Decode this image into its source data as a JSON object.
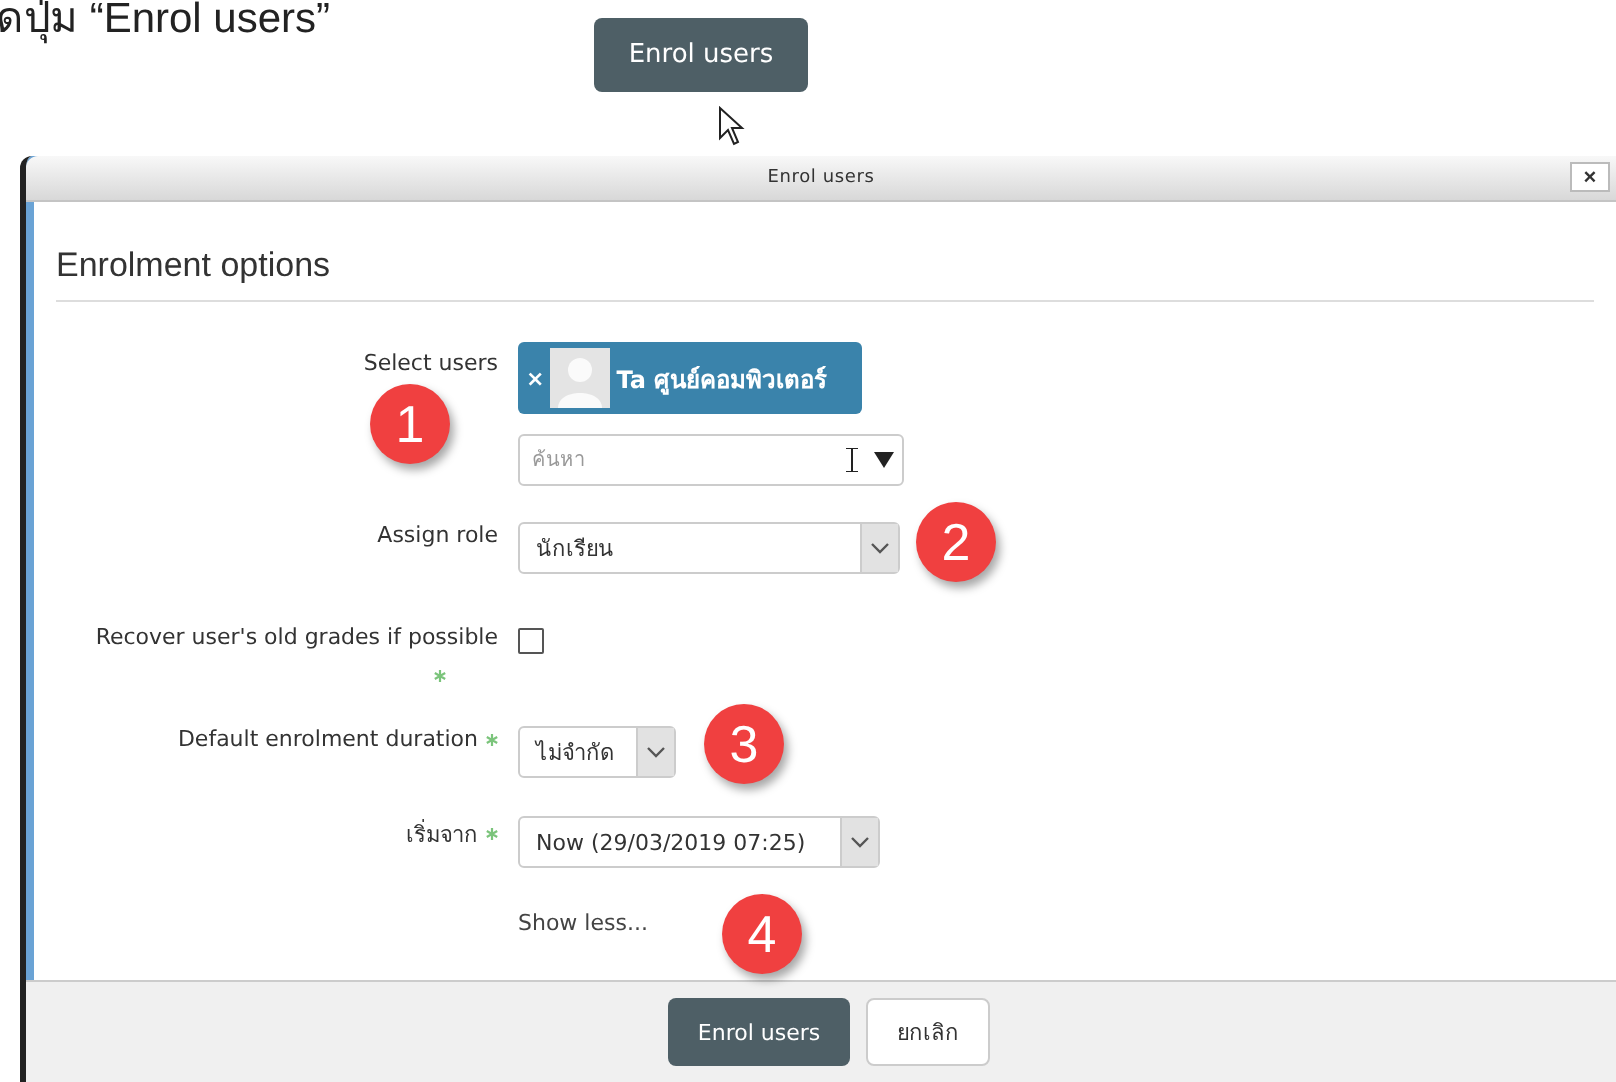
{
  "instruction": {
    "text": "ดปุ่ม “Enrol users”"
  },
  "trigger_button": {
    "label": "Enrol users"
  },
  "dialog": {
    "title": "Enrol users",
    "close": "×",
    "heading": "Enrolment options",
    "fields": [
      {
        "kind": "autocomplete",
        "label": "Select users",
        "required": false,
        "chips": [
          {
            "remove": "×",
            "name": "Ta ศูนย์คอมพิวเตอร์"
          }
        ],
        "placeholder": "ค้นหา"
      },
      {
        "kind": "select",
        "label": "Assign role",
        "required": false,
        "value": "นักเรียน"
      },
      {
        "kind": "checkbox",
        "label": "Recover user's old grades if possible",
        "required": true,
        "checked": false
      },
      {
        "kind": "select",
        "label": "Default enrolment duration",
        "required": true,
        "value": "ไม่จำกัด"
      },
      {
        "kind": "select",
        "label": "เริ่มจาก",
        "required": true,
        "value": "Now (29/03/2019 07:25)"
      },
      {
        "kind": "link",
        "label": "Show less..."
      }
    ],
    "buttons": [
      {
        "label": "Enrol users",
        "kind": "primary"
      },
      {
        "label": "ยกเลิก",
        "kind": "secondary"
      }
    ]
  },
  "markers": [
    {
      "label": "1"
    },
    {
      "label": "2"
    },
    {
      "label": "3"
    },
    {
      "label": "4"
    }
  ]
}
